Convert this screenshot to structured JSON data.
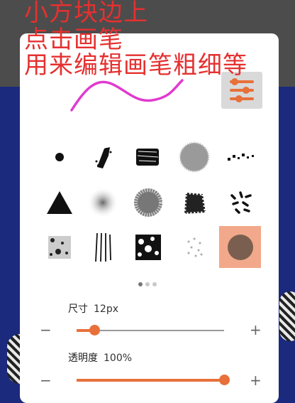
{
  "annotation": {
    "lines": [
      "小方块边上",
      "点击画笔",
      "用来编辑画笔粗细等"
    ]
  },
  "menu_icon": "slider-settings-icon",
  "brushes": [
    {
      "name": "round-dot"
    },
    {
      "name": "chalk-stroke"
    },
    {
      "name": "charcoal-block"
    },
    {
      "name": "noise-circle"
    },
    {
      "name": "scatter-squares"
    },
    {
      "name": "dark-triangle"
    },
    {
      "name": "soft-airbrush"
    },
    {
      "name": "speckle-circle"
    },
    {
      "name": "rough-texture"
    },
    {
      "name": "scatter-dashes"
    },
    {
      "name": "grunge-square"
    },
    {
      "name": "bristle-lines"
    },
    {
      "name": "splatter-block"
    },
    {
      "name": "faint-dots"
    },
    {
      "name": "selected-circle",
      "selected": true
    }
  ],
  "pager": {
    "count": 3,
    "active": 0
  },
  "size_slider": {
    "label": "尺寸",
    "value_text": "12px",
    "level": 0.12,
    "minus": "−",
    "plus": "+"
  },
  "opacity_slider": {
    "label": "透明度",
    "value_text": "100%",
    "level": 1.0,
    "minus": "−",
    "plus": "+"
  },
  "colors": {
    "accent": "#e8703a",
    "selected_bg": "#f2a88a",
    "background": "#1b2a7d",
    "annotation": "#e53030",
    "squiggle": "#e03ad0"
  }
}
